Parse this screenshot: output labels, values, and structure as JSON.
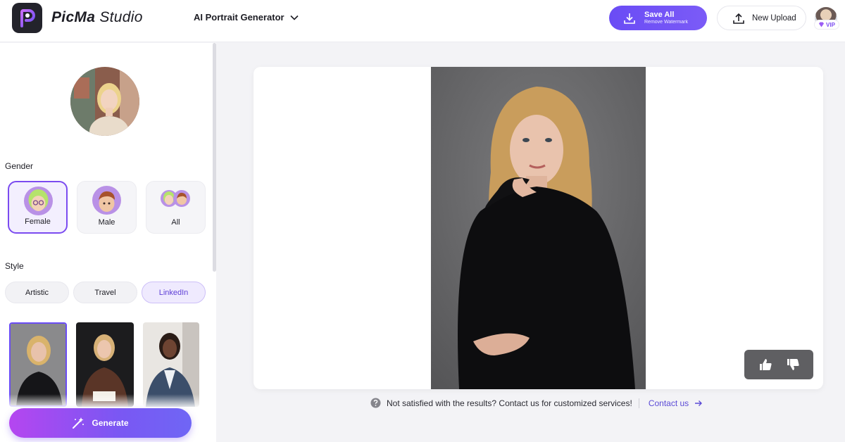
{
  "app": {
    "brand_bold": "PicMa",
    "brand_light": " Studio"
  },
  "header": {
    "tool_name": "AI Portrait Generator",
    "save": {
      "title": "Save All",
      "subtitle": "Remove Watermark"
    },
    "upload_label": "New Upload",
    "vip_label": "VIP"
  },
  "sidebar": {
    "gender_title": "Gender",
    "genders": [
      {
        "label": "Female",
        "selected": true
      },
      {
        "label": "Male",
        "selected": false
      },
      {
        "label": "All",
        "selected": false
      }
    ],
    "style_title": "Style",
    "styles": [
      {
        "label": "Artistic",
        "selected": false
      },
      {
        "label": "Travel",
        "selected": false
      },
      {
        "label": "LinkedIn",
        "selected": true
      }
    ],
    "generate_label": "Generate"
  },
  "main": {
    "feedback_text": "Not satisfied with the results? Contact us for customized services!",
    "contact_label": "Contact us"
  },
  "colors": {
    "accent": "#6a4cf5",
    "accent_gradient_start": "#b546f0",
    "page_bg": "#f3f3f6"
  },
  "icons": [
    "picma-logo-icon",
    "chevron-down-icon",
    "download-icon",
    "upload-icon",
    "diamond-icon",
    "magic-wand-icon",
    "thumbs-up-icon",
    "thumbs-down-icon",
    "help-circle-icon",
    "arrow-right-icon"
  ]
}
